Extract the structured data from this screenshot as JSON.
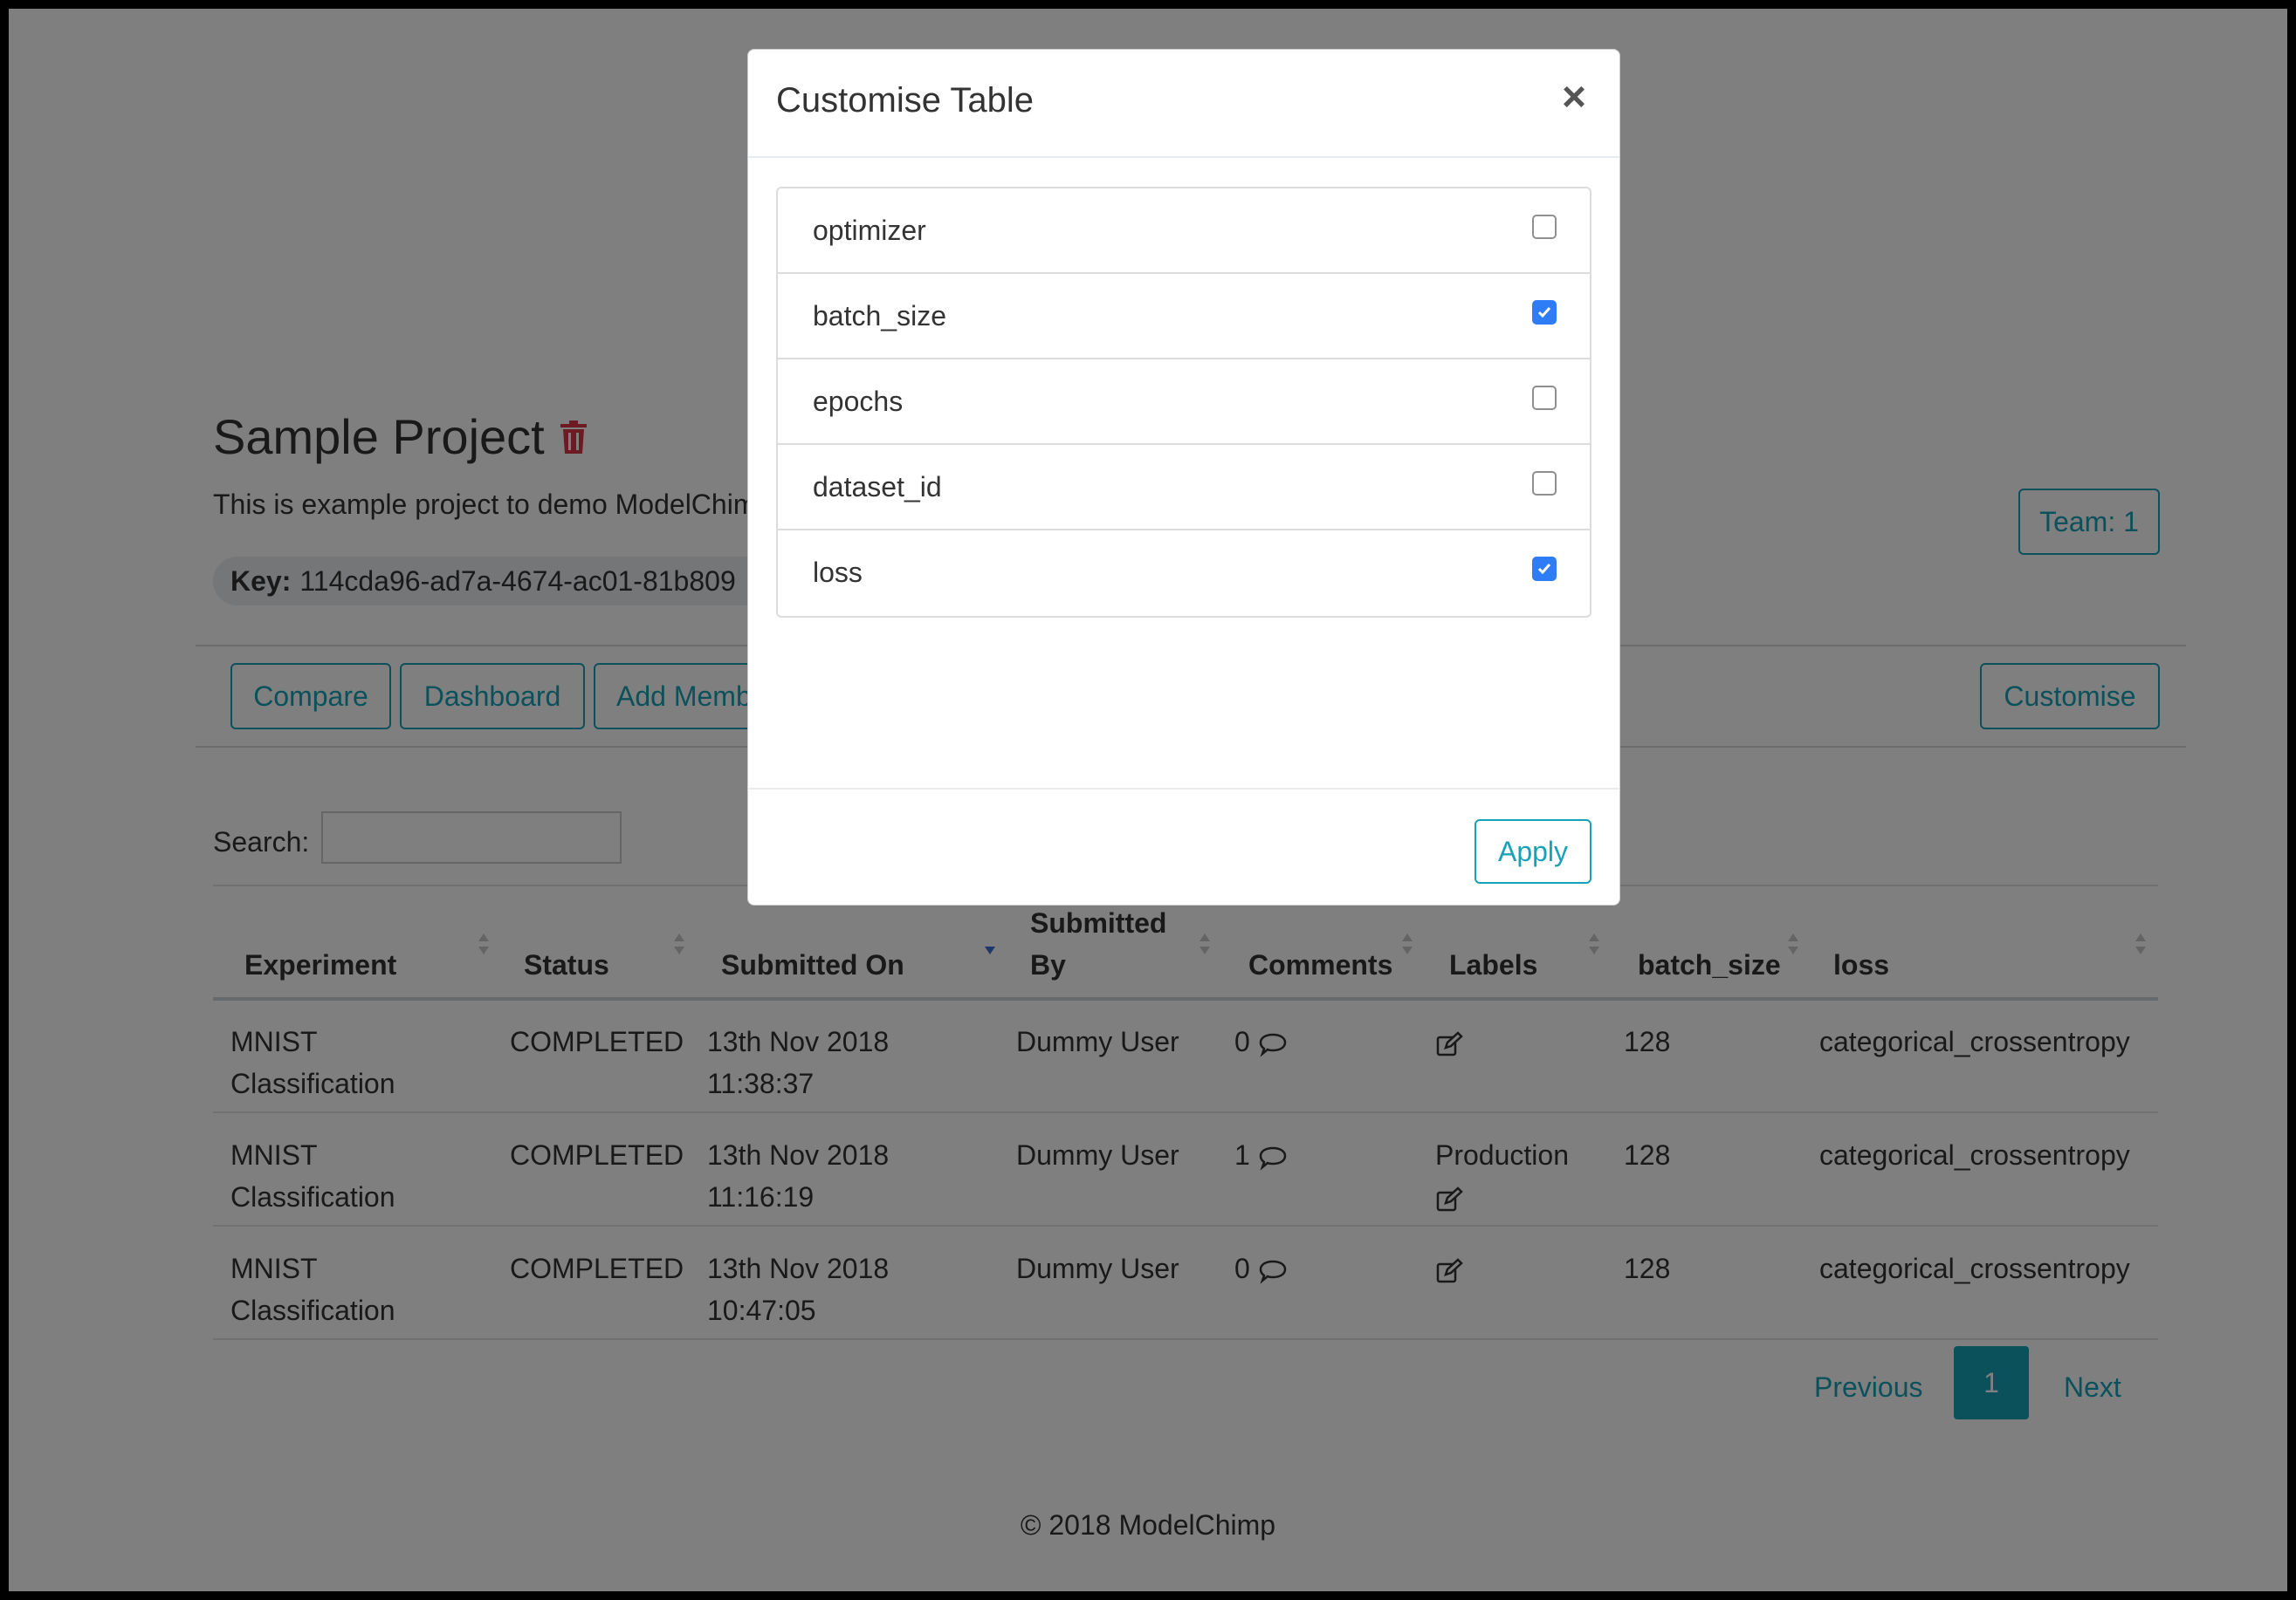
{
  "project": {
    "title": "Sample Project",
    "description": "This is example project to demo ModelChimp",
    "key_label": "Key:",
    "key_value": "114cda96-ad7a-4674-ac01-81b809"
  },
  "team_button": "Team: 1",
  "toolbar": {
    "compare": "Compare",
    "dashboard": "Dashboard",
    "add_member": "Add Member",
    "customise": "Customise"
  },
  "search": {
    "label": "Search:",
    "value": ""
  },
  "table": {
    "headers": {
      "experiment": "Experiment",
      "status": "Status",
      "submitted_on": "Submitted On",
      "submitted_by_top": "Submitted",
      "submitted_by_bottom": "By",
      "comments": "Comments",
      "labels": "Labels",
      "batch_size": "batch_size",
      "loss": "loss"
    },
    "rows": [
      {
        "exp1": "MNIST",
        "exp2": "Classification",
        "status": "COMPLETED",
        "date": "13th Nov 2018",
        "time": "11:38:37",
        "by": "Dummy User",
        "comments": "0",
        "label": "",
        "batch_size": "128",
        "loss": "categorical_crossentropy"
      },
      {
        "exp1": "MNIST",
        "exp2": "Classification",
        "status": "COMPLETED",
        "date": "13th Nov 2018",
        "time": "11:16:19",
        "by": "Dummy User",
        "comments": "1",
        "label": "Production",
        "batch_size": "128",
        "loss": "categorical_crossentropy"
      },
      {
        "exp1": "MNIST",
        "exp2": "Classification",
        "status": "COMPLETED",
        "date": "13th Nov 2018",
        "time": "10:47:05",
        "by": "Dummy User",
        "comments": "0",
        "label": "",
        "batch_size": "128",
        "loss": "categorical_crossentropy"
      }
    ]
  },
  "pagination": {
    "previous": "Previous",
    "current": "1",
    "next": "Next"
  },
  "footer": "© 2018 ModelChimp",
  "modal": {
    "title": "Customise Table",
    "close": "×",
    "options": [
      {
        "label": "optimizer",
        "checked": false
      },
      {
        "label": "batch_size",
        "checked": true
      },
      {
        "label": "epochs",
        "checked": false
      },
      {
        "label": "dataset_id",
        "checked": false
      },
      {
        "label": "loss",
        "checked": true
      }
    ],
    "apply": "Apply"
  },
  "colors": {
    "accent": "#17a2b8",
    "checkbox": "#2f7df6",
    "danger": "#dc3545",
    "overlay": "rgba(0,0,0,0.5)"
  }
}
